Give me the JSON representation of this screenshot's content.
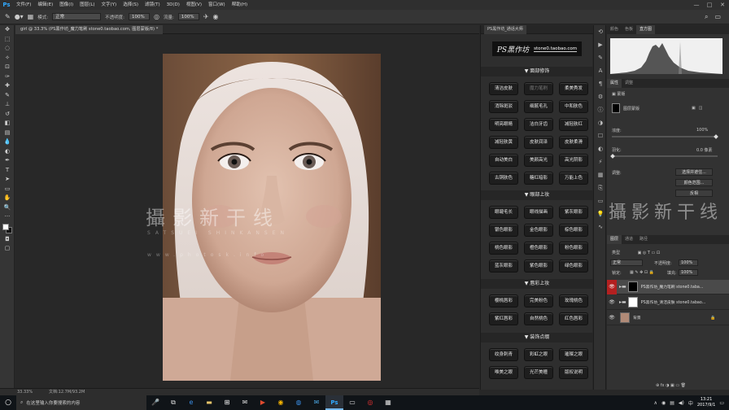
{
  "menubar": {
    "logo": "Ps",
    "items": [
      "文件(F)",
      "编辑(E)",
      "图像(I)",
      "图层(L)",
      "文字(Y)",
      "选择(S)",
      "滤镜(T)",
      "3D(D)",
      "视图(V)",
      "窗口(W)",
      "帮助(H)"
    ],
    "controls": [
      "—",
      "□",
      "✕"
    ]
  },
  "options": {
    "mode_label": "模式:",
    "mode_value": "正常",
    "opacity_label": "不透明度:",
    "opacity_value": "100%",
    "flow_label": "流量:",
    "flow_value": "100%"
  },
  "document": {
    "tab_title": "girl @ 33.3% (PS黑作坊_魔力笔刷 stone0.taobao.com, 图层蒙版/8) *",
    "zoom": "33.33%",
    "info": "文档:12.7M/93.2M"
  },
  "plugin": {
    "panel_tab": "PS黑作坊_通话大师",
    "logo_text": "PS黑作坊",
    "logo_url": "stone0.taobao.com",
    "sections": [
      {
        "title": "▼ 面部修饰",
        "buttons": [
          "清洁皮肤",
          "魔力笔刷",
          "柔美秀发",
          "消除斑驳",
          "细腻毛孔",
          "中和肤色",
          "明亮眼睛",
          "洁白牙齿",
          "减轻肤红",
          "减轻肤黄",
          "皮肤润泽",
          "皮肤柔滑",
          "自动美白",
          "美颜高光",
          "高光阴影",
          "古铜肤色",
          "糖红暗影",
          "万能上色"
        ]
      },
      {
        "title": "▼ 眼部上妆",
        "buttons": [
          "眼睫毛长",
          "眼线描画",
          "紫灰眼影",
          "银色眼影",
          "金色眼影",
          "棕色眼影",
          "桃色眼影",
          "橙色眼影",
          "粉色眼影",
          "蓝灰眼影",
          "紫色眼影",
          "绿色眼影"
        ]
      },
      {
        "title": "▼ 唇彩上妆",
        "buttons": [
          "樱桃唇彩",
          "完美粉色",
          "玫瑰桃色",
          "紫红唇彩",
          "自然桃色",
          "红色唇彩"
        ]
      },
      {
        "title": "▼ 装饰点缀",
        "buttons": [
          "纹身刺青",
          "彩虹之眼",
          "璀璨之眼",
          "唯美之眼",
          "光芒美瞳",
          "版权说明"
        ]
      }
    ]
  },
  "histogram_panel": {
    "tabs": [
      "颜色",
      "色板",
      "直方图"
    ]
  },
  "properties_panel": {
    "tabs": [
      "属性",
      "调整"
    ],
    "header": "蒙版",
    "mask_label": "图层蒙版",
    "density_label": "浓度:",
    "density_value": "100%",
    "feather_label": "羽化:",
    "feather_value": "0.0 像素",
    "adjust_label": "调整:",
    "btn_select_mask": "选择并遮住...",
    "btn_color_range": "颜色范围...",
    "btn_invert": "反相"
  },
  "layers_panel": {
    "tabs": [
      "图层",
      "通道",
      "路径"
    ],
    "kind_label": "类型",
    "blend_value": "正常",
    "opacity_label": "不透明度:",
    "opacity_value": "100%",
    "lock_label": "锁定:",
    "fill_label": "填充:",
    "fill_value": "100%",
    "layers": [
      {
        "name": "PS黑作坊_魔力笔刷 stone0.taba...",
        "selected": true
      },
      {
        "name": "PS黑作坊_清洁皮肤 stone0.tabao...",
        "selected": false
      },
      {
        "name": "背景",
        "selected": false
      }
    ]
  },
  "watermark": {
    "cn": "攝影新干线",
    "en": "SATSUEI SHINKANSEN",
    "url": "www.photosk.info"
  },
  "taskbar": {
    "search_placeholder": "在这里输入你要搜索的内容",
    "time": "13:21",
    "date": "2017/9/1"
  }
}
